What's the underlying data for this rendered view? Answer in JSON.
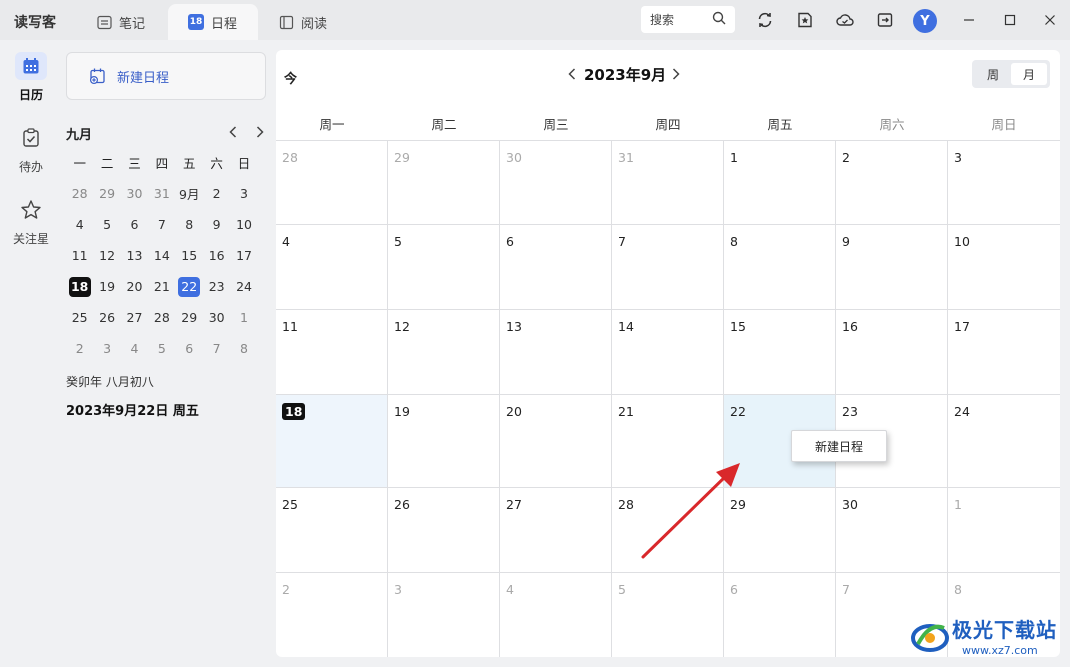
{
  "app": {
    "name": "读写客"
  },
  "tabs": [
    {
      "label": "笔记",
      "icon": "note-icon"
    },
    {
      "label": "日程",
      "icon": "calendar-badge-icon",
      "badge": "18"
    },
    {
      "label": "阅读",
      "icon": "book-icon"
    }
  ],
  "toolbar": {
    "search_label": "搜索",
    "avatar_letter": "Y"
  },
  "rail": [
    {
      "label": "日历",
      "icon": "calendar-icon"
    },
    {
      "label": "待办",
      "icon": "todo-icon"
    },
    {
      "label": "关注星",
      "icon": "star-icon"
    }
  ],
  "sidebar": {
    "new_event_label": "新建日程",
    "mini_month": "九月",
    "weekdays": [
      "一",
      "二",
      "三",
      "四",
      "五",
      "六",
      "日"
    ],
    "days": [
      [
        "28",
        "29",
        "30",
        "31",
        "9月",
        "2",
        "3"
      ],
      [
        "4",
        "5",
        "6",
        "7",
        "8",
        "9",
        "10"
      ],
      [
        "11",
        "12",
        "13",
        "14",
        "15",
        "16",
        "17"
      ],
      [
        "18",
        "19",
        "20",
        "21",
        "22",
        "23",
        "24"
      ],
      [
        "25",
        "26",
        "27",
        "28",
        "29",
        "30",
        "1"
      ],
      [
        "2",
        "3",
        "4",
        "5",
        "6",
        "7",
        "8"
      ]
    ],
    "today": "18",
    "selected": "22",
    "lunar": "癸卯年  八月初八",
    "full_date": "2023年9月22日  周五"
  },
  "calendar": {
    "today_label": "今",
    "title": "2023年9月",
    "view_week": "周",
    "view_month": "月",
    "weekdays": [
      "周一",
      "周二",
      "周三",
      "周四",
      "周五",
      "周六",
      "周日"
    ],
    "weeks": [
      [
        "28",
        "29",
        "30",
        "31",
        "1",
        "2",
        "3"
      ],
      [
        "4",
        "5",
        "6",
        "7",
        "8",
        "9",
        "10"
      ],
      [
        "11",
        "12",
        "13",
        "14",
        "15",
        "16",
        "17"
      ],
      [
        "18",
        "19",
        "20",
        "21",
        "22",
        "23",
        "24"
      ],
      [
        "25",
        "26",
        "27",
        "28",
        "29",
        "30",
        "1"
      ],
      [
        "2",
        "3",
        "4",
        "5",
        "6",
        "7",
        "8"
      ]
    ],
    "today": "18",
    "selected": "22"
  },
  "context_menu": {
    "new_event": "新建日程"
  },
  "watermark": {
    "text": "极光下载站",
    "url": "www.xz7.com"
  },
  "colors": {
    "accent": "#3f6fe0",
    "arrow": "#d9282b",
    "today_cell": "#eef5fc",
    "selected_cell": "#e7f3fa"
  }
}
